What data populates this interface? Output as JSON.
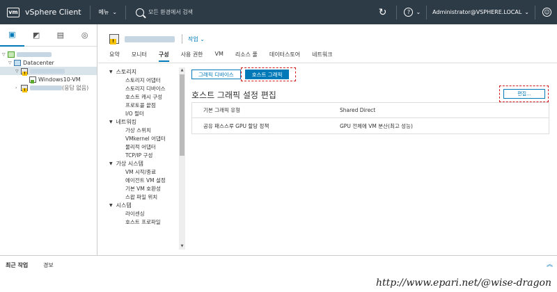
{
  "header": {
    "logo": "vm",
    "title": "vSphere Client",
    "menu_label": "메뉴",
    "search_placeholder": "모든 환경에서 검색",
    "help": "?",
    "user": "Administrator@VSPHERE.LOCAL"
  },
  "tree": {
    "datacenter": "Datacenter",
    "vm": "Windows10-VM",
    "host2_status": "(응답 없음)"
  },
  "object": {
    "actions_label": "작업"
  },
  "tabs": [
    "요약",
    "모니터",
    "구성",
    "사용 권한",
    "VM",
    "리소스 풀",
    "데이터스토어",
    "네트워크"
  ],
  "active_tab": "구성",
  "settings": {
    "groups": [
      {
        "label": "스토리지",
        "items": [
          "스토리지 어댑터",
          "스토리지 디바이스",
          "호스트 캐시 구성",
          "프로토콜 끝점",
          "I/O 필터"
        ]
      },
      {
        "label": "네트워킹",
        "items": [
          "가상 스위치",
          "VMkernel 어댑터",
          "물리적 어댑터",
          "TCP/IP 구성"
        ]
      },
      {
        "label": "가상 시스템",
        "items": [
          "VM 시작/종료",
          "에이전트 VM 설정",
          "기본 VM 호환성",
          "스왑 파일 위치"
        ]
      },
      {
        "label": "시스템",
        "items": [
          "라이센싱",
          "호스트 프로파일"
        ]
      }
    ]
  },
  "panel": {
    "seg_graphics_devices": "그래픽 디바이스",
    "seg_host_graphics": "호스트 그래픽",
    "section_title": "호스트 그래픽 설정 편집",
    "edit_button": "편집...",
    "rows": [
      {
        "key": "기본 그래픽 유형",
        "value": "Shared Direct"
      },
      {
        "key": "공유 패스스루 GPU 할당 정책",
        "value": "GPU 전체에 VM 분산(최고 성능)"
      }
    ]
  },
  "bottom": {
    "recent_tasks": "최근 작업",
    "alarms": "경보"
  },
  "watermark": "http://www.epari.net/@wise-dragon"
}
